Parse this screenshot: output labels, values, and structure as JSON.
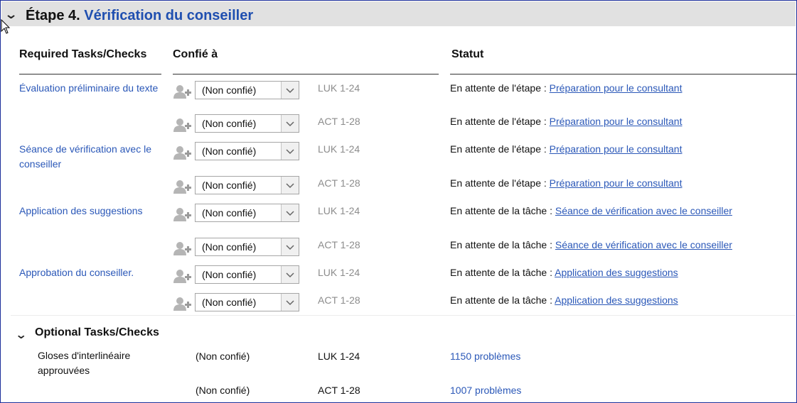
{
  "stage": {
    "number_label": "Étape 4.",
    "name": "Vérification du conseiller"
  },
  "columns": {
    "tasks": "Required Tasks/Checks",
    "assigned": "Confié à",
    "status": "Statut"
  },
  "required_rows": [
    {
      "task": "Évaluation préliminaire du texte",
      "assignee": "(Non confié)",
      "ref": "LUK 1-24",
      "status_prefix": "En attente de l'étape :",
      "status_link": "Préparation pour le consultant"
    },
    {
      "task": "",
      "assignee": "(Non confié)",
      "ref": "ACT 1-28",
      "status_prefix": "En attente de l'étape :",
      "status_link": "Préparation pour le consultant"
    },
    {
      "task": "Séance de vérification avec le conseiller",
      "assignee": "(Non confié)",
      "ref": "LUK 1-24",
      "status_prefix": "En attente de l'étape :",
      "status_link": "Préparation pour le consultant"
    },
    {
      "task": "",
      "assignee": "(Non confié)",
      "ref": "ACT 1-28",
      "status_prefix": "En attente de l'étape :",
      "status_link": "Préparation pour le consultant"
    },
    {
      "task": "Application des suggestions",
      "assignee": "(Non confié)",
      "ref": "LUK 1-24",
      "status_prefix": "En attente de la tâche :",
      "status_link": "Séance de vérification avec le conseiller"
    },
    {
      "task": "",
      "assignee": "(Non confié)",
      "ref": "ACT 1-28",
      "status_prefix": "En attente de la tâche :",
      "status_link": "Séance de vérification avec le conseiller"
    },
    {
      "task": "Approbation du conseiller.",
      "assignee": "(Non confié)",
      "ref": "LUK 1-24",
      "status_prefix": "En attente de la tâche :",
      "status_link": "Application des suggestions"
    },
    {
      "task": "",
      "assignee": "(Non confié)",
      "ref": "ACT 1-28",
      "status_prefix": "En attente de la tâche :",
      "status_link": "Application des suggestions"
    }
  ],
  "optional": {
    "title": "Optional Tasks/Checks",
    "rows": [
      {
        "task": "Gloses d'interlinéaire approuvées",
        "assignee": "(Non confié)",
        "ref": "LUK 1-24",
        "problems": "1150 problèmes"
      },
      {
        "task": "",
        "assignee": "(Non confié)",
        "ref": "ACT 1-28",
        "problems": "1007 problèmes"
      }
    ]
  },
  "colors": {
    "accent": "#1f4fb0",
    "link": "#2b58b8",
    "header_bg": "#e1e1e1",
    "border": "#1c2f9a",
    "muted": "#8c8c8c"
  },
  "icons": {
    "collapse": "chevron-down-icon",
    "assign": "add-user-icon",
    "dropdown": "dropdown-arrow-icon",
    "cursor": "mouse-pointer-icon"
  }
}
